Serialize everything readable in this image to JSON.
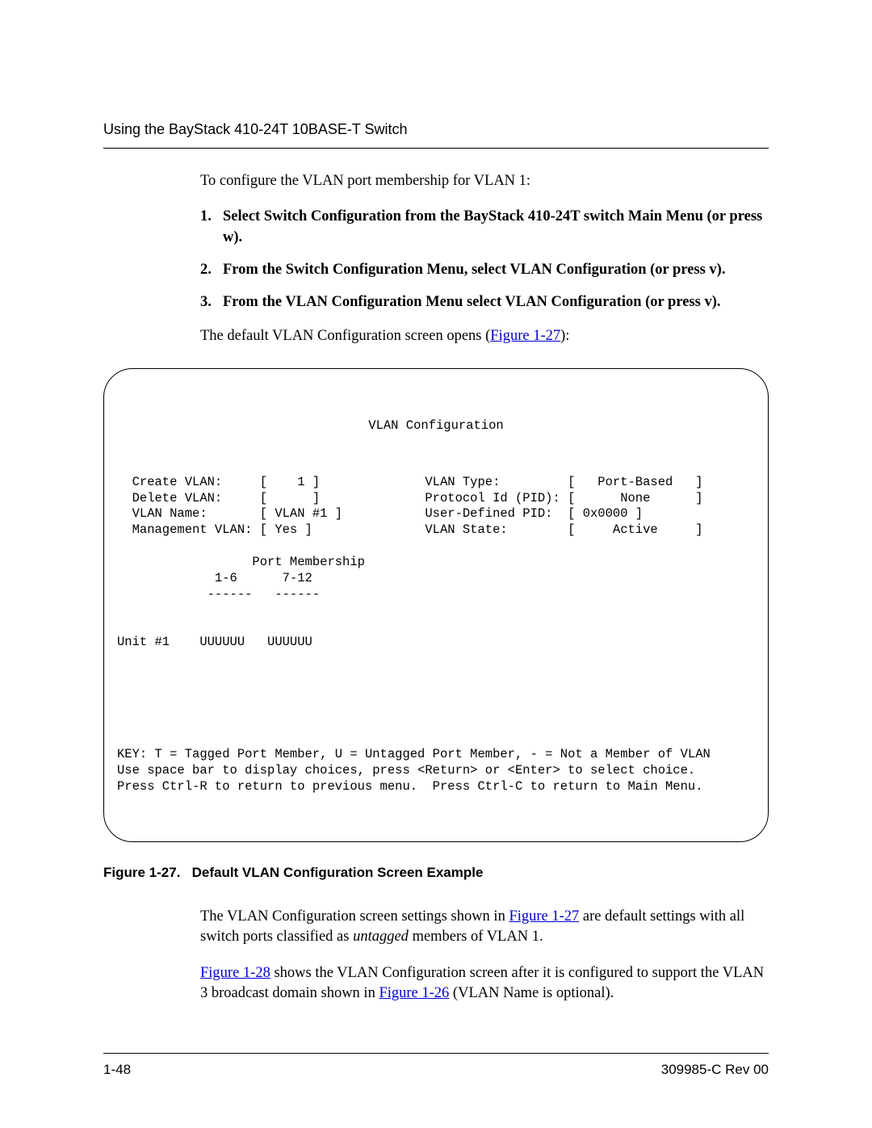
{
  "header": {
    "running": "Using the BayStack 410-24T 10BASE-T Switch"
  },
  "intro": "To configure the VLAN port membership for VLAN 1:",
  "steps": {
    "s1": "Select Switch Configuration from the BayStack 410-24T switch Main Menu (or press w).",
    "s2": "From the Switch Configuration Menu, select VLAN Configuration (or press v).",
    "s3": "From the VLAN Configuration Menu select VLAN Configuration (or press v)."
  },
  "after_steps_pre": "The default VLAN Configuration screen opens (",
  "after_steps_link": "Figure 1-27",
  "after_steps_post": "):",
  "terminal": {
    "title": "VLAN Configuration",
    "body": "  Create VLAN:     [    1 ]              VLAN Type:         [   Port-Based   ]\n  Delete VLAN:     [      ]              Protocol Id (PID): [      None      ]\n  VLAN Name:       [ VLAN #1 ]           User-Defined PID:  [ 0x0000 ]\n  Management VLAN: [ Yes ]               VLAN State:        [     Active     ]\n\n                  Port Membership\n             1-6      7-12\n            ------   ------\n\n\nUnit #1    UUUUUU   UUUUUU\n\n\n\n\n\n\nKEY: T = Tagged Port Member, U = Untagged Port Member, - = Not a Member of VLAN\nUse space bar to display choices, press <Return> or <Enter> to select choice.\nPress Ctrl-R to return to previous menu.  Press Ctrl-C to return to Main Menu."
  },
  "caption": {
    "label": "Figure 1-27.",
    "text": "Default VLAN Configuration Screen Example"
  },
  "para1": {
    "pre": "The VLAN Configuration screen settings shown in ",
    "link": "Figure 1-27",
    "mid": " are default settings with all switch ports classified as ",
    "ital": "untagged",
    "post": " members of VLAN 1."
  },
  "para2": {
    "link1": "Figure 1-28",
    "mid": " shows the VLAN Configuration screen after it is configured to support the VLAN 3 broadcast domain shown in ",
    "link2": "Figure 1-26",
    "post": " (VLAN Name is optional)."
  },
  "footer": {
    "page": "1-48",
    "rev": "309985-C Rev 00"
  }
}
